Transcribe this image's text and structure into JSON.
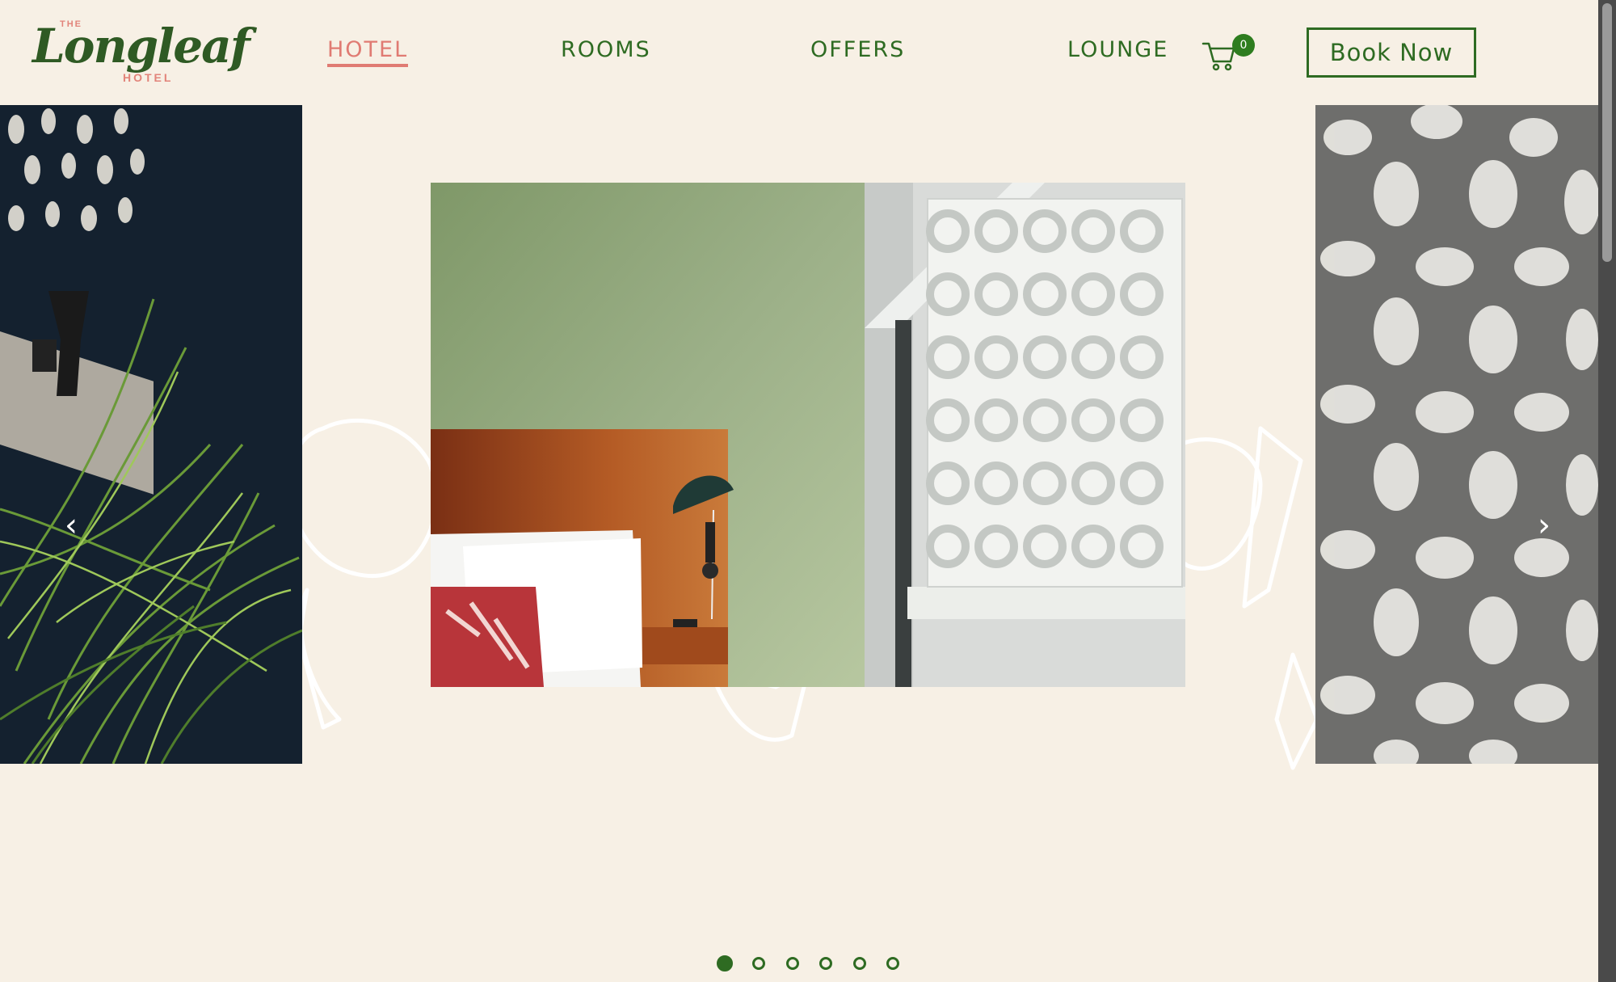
{
  "header": {
    "logo": {
      "the": "THE",
      "brand": "Longleaf",
      "hotel": "HOTEL"
    },
    "nav": [
      {
        "label": "HOTEL",
        "active": true
      },
      {
        "label": "ROOMS",
        "active": false
      },
      {
        "label": "OFFERS",
        "active": false
      },
      {
        "label": "LOUNGE",
        "active": false
      }
    ],
    "cart_count": "0",
    "book_label": "Book Now"
  },
  "carousel": {
    "prev_arrow": "‹",
    "next_arrow": "›",
    "slide_count": 6,
    "active_slide": 1
  },
  "colors": {
    "background": "#f7f0e5",
    "primary_green": "#2e6b22",
    "accent_coral": "#e07b73"
  },
  "icons": {
    "cart": "shopping-cart-icon",
    "prev": "chevron-left-icon",
    "next": "chevron-right-icon"
  }
}
